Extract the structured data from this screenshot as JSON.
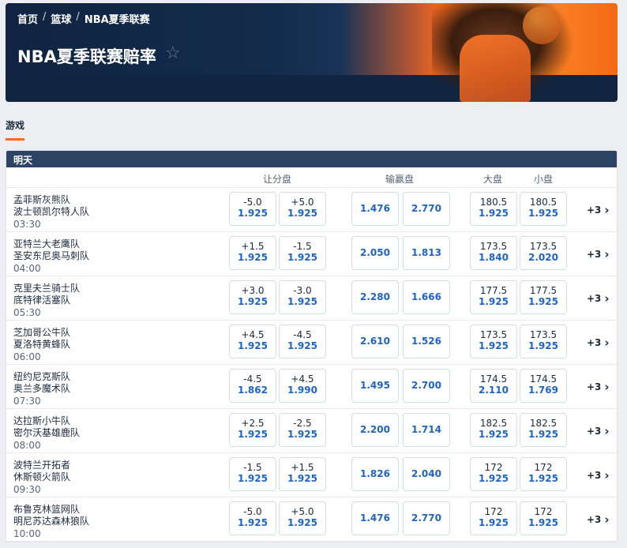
{
  "breadcrumb": [
    "首页",
    "篮球",
    "NBA夏季联赛"
  ],
  "page_title": "NBA夏季联赛赔率",
  "tab": "游戏",
  "section": "明天",
  "columns": {
    "handicap": "让分盘",
    "moneyline": "输赢盘",
    "over": "大盘",
    "under": "小盘"
  },
  "matches": [
    {
      "home": "孟菲斯灰熊队",
      "away": "波士顿凯尔特人队",
      "time": "03:30",
      "h1_line": "-5.0",
      "h1_price": "1.925",
      "h2_line": "+5.0",
      "h2_price": "1.925",
      "ml1": "1.476",
      "ml2": "2.770",
      "o_line": "180.5",
      "o_price": "1.925",
      "u_line": "180.5",
      "u_price": "1.925",
      "more": "+3"
    },
    {
      "home": "亚特兰大老鹰队",
      "away": "圣安东尼奥马刺队",
      "time": "04:00",
      "h1_line": "+1.5",
      "h1_price": "1.925",
      "h2_line": "-1.5",
      "h2_price": "1.925",
      "ml1": "2.050",
      "ml2": "1.813",
      "o_line": "173.5",
      "o_price": "1.840",
      "u_line": "173.5",
      "u_price": "2.020",
      "more": "+3"
    },
    {
      "home": "克里夫兰骑士队",
      "away": "底特律活塞队",
      "time": "05:30",
      "h1_line": "+3.0",
      "h1_price": "1.925",
      "h2_line": "-3.0",
      "h2_price": "1.925",
      "ml1": "2.280",
      "ml2": "1.666",
      "o_line": "177.5",
      "o_price": "1.925",
      "u_line": "177.5",
      "u_price": "1.925",
      "more": "+3"
    },
    {
      "home": "芝加哥公牛队",
      "away": "夏洛特黄蜂队",
      "time": "06:00",
      "h1_line": "+4.5",
      "h1_price": "1.925",
      "h2_line": "-4.5",
      "h2_price": "1.925",
      "ml1": "2.610",
      "ml2": "1.526",
      "o_line": "173.5",
      "o_price": "1.925",
      "u_line": "173.5",
      "u_price": "1.925",
      "more": "+3"
    },
    {
      "home": "纽约尼克斯队",
      "away": "奥兰多魔术队",
      "time": "07:30",
      "h1_line": "-4.5",
      "h1_price": "1.862",
      "h2_line": "+4.5",
      "h2_price": "1.990",
      "ml1": "1.495",
      "ml2": "2.700",
      "o_line": "174.5",
      "o_price": "2.110",
      "u_line": "174.5",
      "u_price": "1.769",
      "more": "+3"
    },
    {
      "home": "达拉斯小牛队",
      "away": "密尔沃基雄鹿队",
      "time": "08:00",
      "h1_line": "+2.5",
      "h1_price": "1.925",
      "h2_line": "-2.5",
      "h2_price": "1.925",
      "ml1": "2.200",
      "ml2": "1.714",
      "o_line": "182.5",
      "o_price": "1.925",
      "u_line": "182.5",
      "u_price": "1.925",
      "more": "+3"
    },
    {
      "home": "波特兰开拓者",
      "away": "休斯顿火箭队",
      "time": "09:30",
      "h1_line": "-1.5",
      "h1_price": "1.925",
      "h2_line": "+1.5",
      "h2_price": "1.925",
      "ml1": "1.826",
      "ml2": "2.040",
      "o_line": "172",
      "o_price": "1.925",
      "u_line": "172",
      "u_price": "1.925",
      "more": "+3"
    },
    {
      "home": "布鲁克林篮网队",
      "away": "明尼苏达森林狼队",
      "time": "10:00",
      "h1_line": "-5.0",
      "h1_price": "1.925",
      "h2_line": "+5.0",
      "h2_price": "1.925",
      "ml1": "1.476",
      "ml2": "2.770",
      "o_line": "172",
      "o_price": "1.925",
      "u_line": "172",
      "u_price": "1.925",
      "more": "+3"
    }
  ]
}
